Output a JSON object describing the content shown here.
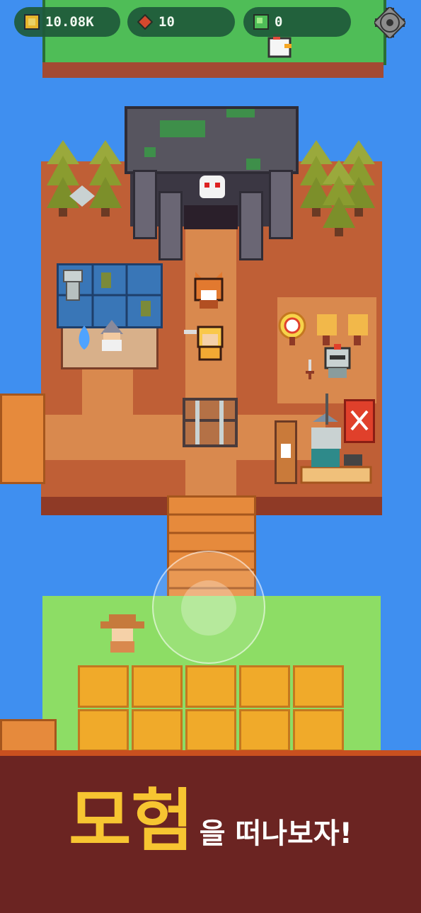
{
  "hud": {
    "gold": {
      "icon": "gold-coin-icon",
      "value": "10.08K"
    },
    "meat": {
      "icon": "meat-icon",
      "value": "10"
    },
    "gem": {
      "icon": "green-gem-icon",
      "value": "0"
    },
    "settings": {
      "icon": "gear-icon"
    }
  },
  "banner": {
    "big_text": "모험",
    "rest_text": "을 떠나보자!"
  },
  "colors": {
    "water": "#3f8ff0",
    "banner_bg": "#6b2422",
    "banner_accent": "#f7c531"
  }
}
